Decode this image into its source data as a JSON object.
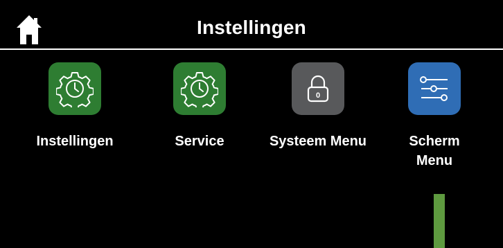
{
  "header": {
    "title": "Instellingen",
    "home_icon": "home-icon"
  },
  "tiles": [
    {
      "label": "Instellingen",
      "icon": "gear-clock-icon",
      "color": "#2e7d32"
    },
    {
      "label": "Service",
      "icon": "gear-clock-icon",
      "color": "#2e7d32"
    },
    {
      "label": "Systeem Menu",
      "icon": "lock-icon",
      "color": "#58595b",
      "lock_code": "0"
    },
    {
      "label": "Scherm\nMenu",
      "icon": "sliders-icon",
      "color": "#2f6db5"
    }
  ],
  "colors": {
    "background": "#000000",
    "text": "#ffffff",
    "scroll_indicator": "#5e9a3f"
  }
}
